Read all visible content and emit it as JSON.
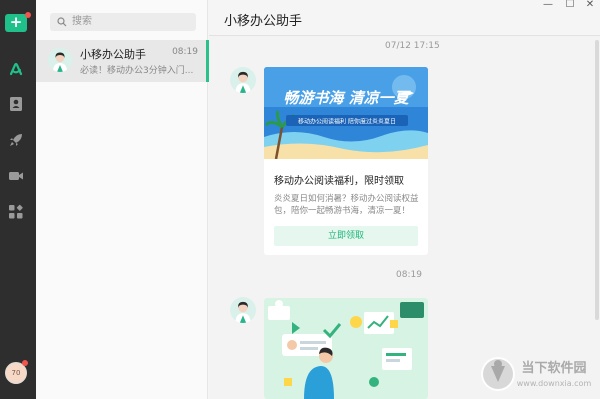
{
  "rail": {
    "add_label": "+",
    "profile_label": "70",
    "icons": [
      "assistant-icon",
      "contacts-icon",
      "rocket-icon",
      "video-icon",
      "apps-icon"
    ]
  },
  "search": {
    "placeholder": "搜索"
  },
  "conversation": {
    "name": "小移办公助手",
    "time": "08:19",
    "preview": "必读！移动办公3分钟入门..."
  },
  "header": {
    "title": "小移办公助手"
  },
  "messages": [
    {
      "timestamp": "07/12 17:15",
      "banner_title": "畅游书海 清凉一夏",
      "banner_sub": "移动办公阅读福利  陪你度过炎炎夏日",
      "card_title": "移动办公阅读福利，限时领取",
      "card_desc": "炎炎夏日如何消暑？移动办公阅读权益包，陪你一起畅游书海，清凉一夏！",
      "button": "立即领取"
    },
    {
      "timestamp": "08:19"
    }
  ],
  "watermark": {
    "title": "当下软件园",
    "url": "www.downxia.com"
  },
  "colors": {
    "accent": "#20c08a",
    "rail": "#2e2e2e",
    "banner": "#2f86d8"
  }
}
